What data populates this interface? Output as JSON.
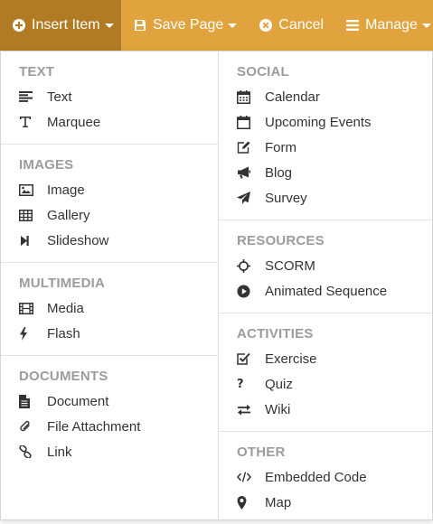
{
  "toolbar": {
    "insert_label": "Insert Item",
    "save_label": "Save Page",
    "cancel_label": "Cancel",
    "manage_label": "Manage",
    "accent_color": "#e0a33d",
    "active_color": "#b07b23"
  },
  "menu": {
    "left": [
      {
        "heading": "TEXT",
        "items": [
          {
            "label": "Text",
            "icon": "align-left-icon"
          },
          {
            "label": "Marquee",
            "icon": "text-height-icon"
          }
        ]
      },
      {
        "heading": "IMAGES",
        "items": [
          {
            "label": "Image",
            "icon": "picture-icon"
          },
          {
            "label": "Gallery",
            "icon": "grid-icon"
          },
          {
            "label": "Slideshow",
            "icon": "step-forward-icon"
          }
        ]
      },
      {
        "heading": "MULTIMEDIA",
        "items": [
          {
            "label": "Media",
            "icon": "film-icon"
          },
          {
            "label": "Flash",
            "icon": "bolt-icon"
          }
        ]
      },
      {
        "heading": "DOCUMENTS",
        "items": [
          {
            "label": "Document",
            "icon": "file-icon"
          },
          {
            "label": "File Attachment",
            "icon": "paperclip-icon"
          },
          {
            "label": "Link",
            "icon": "link-icon"
          }
        ]
      }
    ],
    "right": [
      {
        "heading": "SOCIAL",
        "items": [
          {
            "label": "Calendar",
            "icon": "calendar-icon"
          },
          {
            "label": "Upcoming Events",
            "icon": "calendar-empty-icon"
          },
          {
            "label": "Form",
            "icon": "edit-icon"
          },
          {
            "label": "Blog",
            "icon": "bullhorn-icon"
          },
          {
            "label": "Survey",
            "icon": "paper-plane-icon"
          }
        ]
      },
      {
        "heading": "RESOURCES",
        "items": [
          {
            "label": "SCORM",
            "icon": "crosshairs-icon"
          },
          {
            "label": "Animated Sequence",
            "icon": "play-circle-icon"
          }
        ]
      },
      {
        "heading": "ACTIVITIES",
        "items": [
          {
            "label": "Exercise",
            "icon": "check-square-icon"
          },
          {
            "label": "Quiz",
            "icon": "question-icon"
          },
          {
            "label": "Wiki",
            "icon": "exchange-icon"
          }
        ]
      },
      {
        "heading": "OTHER",
        "items": [
          {
            "label": "Embedded Code",
            "icon": "code-icon"
          },
          {
            "label": "Map",
            "icon": "map-marker-icon"
          }
        ]
      }
    ]
  }
}
